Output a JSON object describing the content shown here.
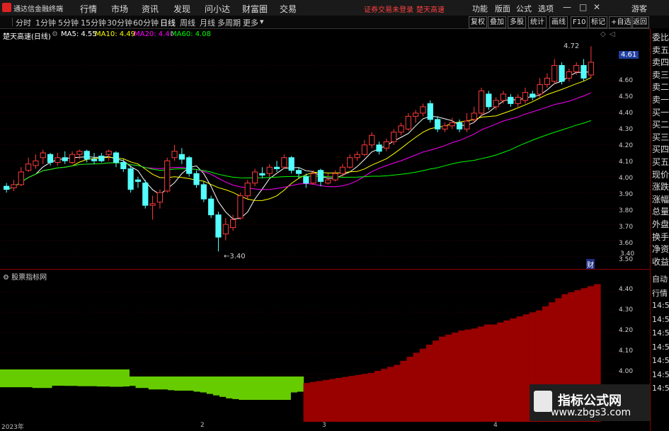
{
  "app": {
    "name": "通达信金融终端",
    "menus": [
      "行情",
      "市场",
      "资讯",
      "发现",
      "问小达",
      "财富圈",
      "交易"
    ],
    "warning": "证券交易未登录",
    "stock_name_top": "楚天高速",
    "right_menus": [
      "功能",
      "版面",
      "公式",
      "选项"
    ],
    "guest": "游客"
  },
  "toolbar": {
    "periods": [
      "分时",
      "1分钟",
      "5分钟",
      "15分钟",
      "30分钟",
      "60分钟",
      "日线",
      "周线",
      "月线",
      "多周期",
      "更多"
    ],
    "selected": "日线",
    "right_buttons": [
      "复权",
      "叠加",
      "多股",
      "统计",
      "画线",
      "F10",
      "标记",
      "+自选",
      "返回"
    ]
  },
  "chart_header": {
    "title": "楚天高速(日线)",
    "ma5": "MA5: 4.55",
    "ma10": "MA10: 4.49",
    "ma20": "MA20: 4.40",
    "ma60": "MA60: 4.08"
  },
  "colors": {
    "up": "#ff3b3b",
    "down": "#54ffff",
    "ma5": "#ffffff",
    "ma10": "#ffff00",
    "ma20": "#ff00ff",
    "ma60": "#00ff00",
    "bar_red": "#990000",
    "bar_green": "#66cc00"
  },
  "price_axis": [
    "4.60",
    "4.50",
    "4.40",
    "4.30",
    "4.20",
    "4.10",
    "4.00",
    "3.90",
    "3.80",
    "3.70",
    "3.60",
    "3.50",
    "3.40"
  ],
  "current_price": "4.61",
  "annotations": {
    "high": "4.72",
    "low": "3.40",
    "cai": "财"
  },
  "sidebar_top": [
    "委比",
    "卖五",
    "卖四",
    "卖三",
    "卖二",
    "卖一",
    "买一",
    "买二",
    "买三",
    "买四",
    "买五",
    "现价",
    "涨跌",
    "涨幅",
    "总量",
    "外盘",
    "换手",
    "净资",
    "收益"
  ],
  "sidebar_bottom": [
    "自动",
    "行情",
    "14:50",
    "14:50",
    "14:50",
    "14:50",
    "14:50",
    "14:50",
    "14:50"
  ],
  "indicator": {
    "title": "股票指标网",
    "axis": [
      "4.40",
      "4.30",
      "4.20",
      "4.10",
      "4.00"
    ]
  },
  "dates": [
    "2023年",
    "2",
    "3",
    "4"
  ],
  "watermark": {
    "title": "指标公式网",
    "url": "www.zbgs3.com"
  },
  "chart_data": {
    "type": "candlestick",
    "ylim": [
      3.36,
      4.74
    ],
    "candles": [
      [
        3.84,
        3.82,
        3.86,
        3.8
      ],
      [
        3.83,
        3.85,
        3.88,
        3.81
      ],
      [
        3.85,
        3.93,
        3.96,
        3.84
      ],
      [
        3.94,
        3.98,
        4.02,
        3.93
      ],
      [
        3.97,
        4.0,
        4.04,
        3.95
      ],
      [
        4.02,
        4.05,
        4.07,
        3.98
      ],
      [
        4.04,
        3.99,
        4.05,
        3.97
      ],
      [
        3.99,
        4.02,
        4.05,
        3.97
      ],
      [
        4.02,
        4.0,
        4.06,
        3.98
      ],
      [
        3.99,
        4.04,
        4.06,
        3.98
      ],
      [
        4.04,
        4.06,
        4.07,
        4.01
      ],
      [
        4.06,
        4.01,
        4.07,
        3.99
      ],
      [
        4.01,
        4.0,
        4.05,
        3.98
      ],
      [
        4.03,
        4.0,
        4.05,
        3.99
      ],
      [
        4.04,
        4.06,
        4.07,
        4.0
      ],
      [
        4.05,
        3.99,
        4.06,
        3.96
      ],
      [
        3.99,
        3.95,
        4.01,
        3.93
      ],
      [
        3.95,
        3.82,
        3.97,
        3.8
      ],
      [
        3.88,
        3.87,
        3.9,
        3.83
      ],
      [
        3.86,
        3.72,
        3.88,
        3.7
      ],
      [
        3.72,
        3.73,
        3.78,
        3.63
      ],
      [
        3.74,
        3.8,
        3.82,
        3.7
      ],
      [
        3.81,
        4.0,
        4.02,
        3.8
      ],
      [
        4.02,
        4.06,
        4.1,
        4.0
      ],
      [
        4.04,
        4.01,
        4.08,
        3.98
      ],
      [
        4.02,
        3.92,
        4.03,
        3.9
      ],
      [
        3.92,
        3.85,
        3.94,
        3.83
      ],
      [
        3.85,
        3.76,
        3.87,
        3.74
      ],
      [
        3.76,
        3.66,
        3.78,
        3.64
      ],
      [
        3.66,
        3.52,
        3.68,
        3.43
      ],
      [
        3.54,
        3.6,
        3.64,
        3.5
      ],
      [
        3.58,
        3.63,
        3.66,
        3.56
      ],
      [
        3.64,
        3.78,
        3.8,
        3.63
      ],
      [
        3.78,
        3.86,
        3.88,
        3.76
      ],
      [
        3.86,
        3.93,
        3.95,
        3.84
      ],
      [
        3.92,
        3.91,
        3.96,
        3.89
      ],
      [
        3.92,
        3.96,
        3.98,
        3.9
      ],
      [
        3.96,
        3.95,
        4.0,
        3.93
      ],
      [
        3.96,
        4.02,
        4.04,
        3.95
      ],
      [
        4.02,
        3.94,
        4.03,
        3.92
      ],
      [
        3.94,
        3.92,
        3.96,
        3.89
      ],
      [
        3.9,
        3.86,
        3.92,
        3.83
      ],
      [
        3.86,
        3.92,
        3.94,
        3.85
      ],
      [
        3.94,
        3.87,
        3.95,
        3.84
      ],
      [
        3.86,
        3.88,
        3.92,
        3.85
      ],
      [
        3.88,
        3.92,
        3.94,
        3.87
      ],
      [
        3.92,
        3.96,
        3.98,
        3.9
      ],
      [
        3.96,
        4.02,
        4.04,
        3.95
      ],
      [
        4.02,
        4.04,
        4.06,
        4.0
      ],
      [
        4.04,
        4.1,
        4.13,
        4.03
      ],
      [
        4.1,
        4.16,
        4.18,
        4.08
      ],
      [
        4.1,
        4.06,
        4.12,
        4.04
      ],
      [
        4.08,
        4.12,
        4.14,
        4.06
      ],
      [
        4.12,
        4.18,
        4.2,
        4.1
      ],
      [
        4.18,
        4.22,
        4.24,
        4.16
      ],
      [
        4.2,
        4.28,
        4.3,
        4.19
      ],
      [
        4.28,
        4.3,
        4.32,
        4.24
      ],
      [
        4.3,
        4.34,
        4.36,
        4.28
      ],
      [
        4.36,
        4.26,
        4.38,
        4.24
      ],
      [
        4.26,
        4.2,
        4.28,
        4.18
      ],
      [
        4.2,
        4.22,
        4.24,
        4.18
      ],
      [
        4.22,
        4.24,
        4.27,
        4.2
      ],
      [
        4.24,
        4.2,
        4.26,
        4.18
      ],
      [
        4.2,
        4.25,
        4.3,
        4.18
      ],
      [
        4.26,
        4.3,
        4.34,
        4.24
      ],
      [
        4.3,
        4.44,
        4.46,
        4.28
      ],
      [
        4.42,
        4.34,
        4.44,
        4.32
      ],
      [
        4.34,
        4.38,
        4.4,
        4.32
      ],
      [
        4.38,
        4.42,
        4.44,
        4.36
      ],
      [
        4.4,
        4.36,
        4.42,
        4.34
      ],
      [
        4.36,
        4.4,
        4.42,
        4.34
      ],
      [
        4.38,
        4.43,
        4.46,
        4.36
      ],
      [
        4.42,
        4.4,
        4.44,
        4.38
      ],
      [
        4.42,
        4.48,
        4.52,
        4.4
      ],
      [
        4.48,
        4.52,
        4.55,
        4.46
      ],
      [
        4.5,
        4.6,
        4.64,
        4.48
      ],
      [
        4.6,
        4.5,
        4.62,
        4.48
      ],
      [
        4.52,
        4.56,
        4.58,
        4.5
      ],
      [
        4.56,
        4.6,
        4.62,
        4.54
      ],
      [
        4.6,
        4.52,
        4.64,
        4.5
      ],
      [
        4.54,
        4.62,
        4.72,
        4.52
      ]
    ],
    "indicator_values": [
      -0.15,
      -0.15,
      -0.15,
      -0.15,
      -0.15,
      -0.2,
      -0.2,
      -0.2,
      -0.05,
      -0.05,
      -0.06,
      -0.06,
      -0.08,
      -0.08,
      -0.08,
      -0.1,
      -0.1,
      -0.12,
      -0.12,
      -0.1,
      -0.06,
      -0.2,
      -0.2,
      -0.3,
      -0.3,
      -0.3,
      -0.35,
      -0.38,
      -0.38,
      -0.38,
      -0.45,
      -0.5,
      -0.6,
      -0.7,
      -0.8,
      -0.9,
      -0.95,
      -1.0,
      -1.0,
      -1.0,
      -1.0,
      -1.0,
      -1.0,
      -1.0,
      -1.0,
      -0.5,
      -0.45,
      0.1,
      0.15,
      0.2,
      0.25,
      0.3,
      0.35,
      0.4,
      0.45,
      0.5,
      0.55,
      0.6,
      0.7,
      0.8,
      0.9,
      1.0,
      1.2,
      1.4,
      1.6,
      1.8,
      2.0,
      2.2,
      2.4,
      2.5,
      2.6,
      2.7,
      2.75,
      2.8,
      2.9,
      3.0,
      3.0,
      3.1,
      3.2,
      3.3,
      3.4,
      3.5,
      3.6,
      3.7,
      3.9,
      4.1,
      4.3,
      4.5,
      4.6,
      4.7,
      4.8,
      4.9,
      5.0
    ]
  }
}
